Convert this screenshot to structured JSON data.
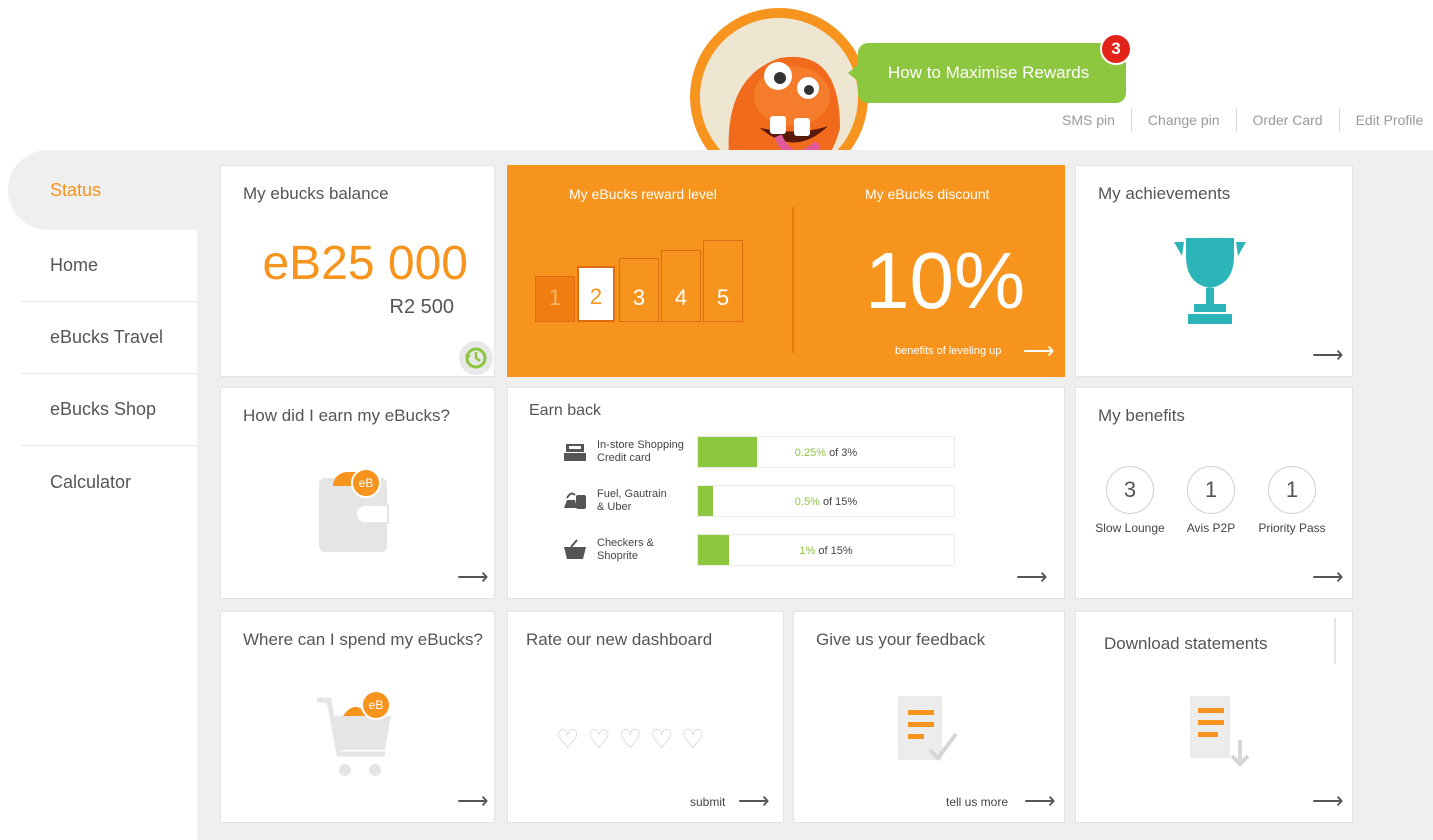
{
  "header": {
    "bubble_text": "How to Maximise Rewards",
    "badge_count": "3",
    "links": [
      "SMS pin",
      "Change pin",
      "Order Card",
      "Edit Profile"
    ]
  },
  "sidebar": {
    "items": [
      {
        "label": "Status",
        "active": true
      },
      {
        "label": "Home"
      },
      {
        "label": "eBucks Travel"
      },
      {
        "label": "eBucks Shop"
      },
      {
        "label": "Calculator"
      }
    ]
  },
  "balance": {
    "title": "My ebucks balance",
    "amount": "eB25 000",
    "rand": "R2 500"
  },
  "reward": {
    "title": "My eBucks reward level",
    "levels": [
      "1",
      "2",
      "3",
      "4",
      "5"
    ],
    "current_level": 2
  },
  "discount": {
    "title": "My eBucks discount",
    "value": "10%",
    "link": "benefits of leveling up"
  },
  "achievements": {
    "title": "My achievements"
  },
  "earn": {
    "title": "How did I earn my eBucks?",
    "coin_label": "eB"
  },
  "earnback": {
    "title": "Earn back",
    "rows": [
      {
        "label1": "In-store Shopping",
        "label2": "Credit card",
        "value": "0.25%",
        "of": "of 3%",
        "fraction": 0.23
      },
      {
        "label1": "Fuel, Gautrain",
        "label2": "& Uber",
        "value": "0.5%",
        "of": "of 15%",
        "fraction": 0.06
      },
      {
        "label1": "Checkers &",
        "label2": "Shoprite",
        "value": "1%",
        "of": "of 15%",
        "fraction": 0.12
      }
    ]
  },
  "benefits": {
    "title": "My benefits",
    "items": [
      {
        "count": "3",
        "label": "Slow Lounge"
      },
      {
        "count": "1",
        "label": "Avis P2P"
      },
      {
        "count": "1",
        "label": "Priority Pass"
      }
    ]
  },
  "spend": {
    "title": "Where can I spend my eBucks?",
    "coin_label": "eB"
  },
  "rate": {
    "title": "Rate our new dashboard",
    "submit": "submit"
  },
  "feedback": {
    "title": "Give us your feedback",
    "link": "tell us more"
  },
  "statements": {
    "title": "Download statements"
  },
  "colors": {
    "orange": "#f7941d",
    "green": "#8dc63f",
    "teal": "#2bb5b8",
    "red": "#e2231a"
  }
}
